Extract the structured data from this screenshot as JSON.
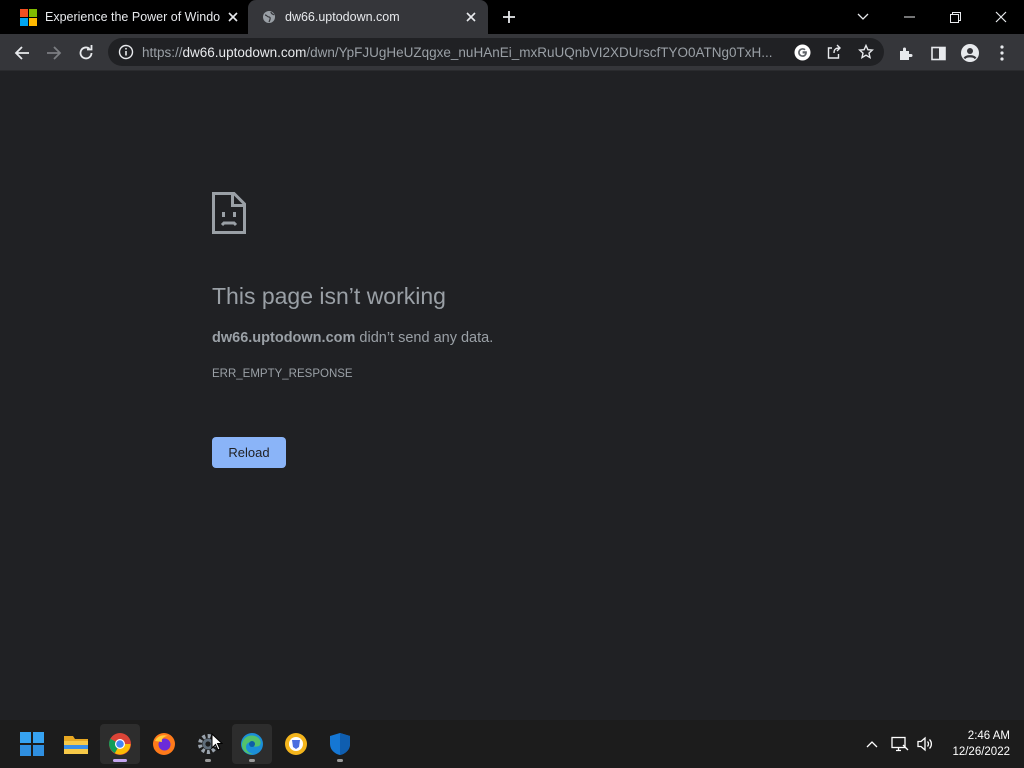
{
  "tabs": [
    {
      "title": "Experience the Power of Windows",
      "favicon": "microsoft-logo",
      "active": false
    },
    {
      "title": "dw66.uptodown.com",
      "favicon": "globe-icon",
      "active": true
    }
  ],
  "url": {
    "scheme": "https://",
    "host": "dw66.uptodown.com",
    "path": "/dwn/YpFJUgHeUZqgxe_nuHAnEi_mxRuUQnbVI2XDUrscfTYO0ATNg0TxH..."
  },
  "error": {
    "title": "This page isn’t working",
    "host": "dw66.uptodown.com",
    "message": "didn’t send any data.",
    "code": "ERR_EMPTY_RESPONSE",
    "reload_label": "Reload"
  },
  "taskbar": {
    "apps": [
      "start-icon",
      "file-explorer-icon",
      "chrome-icon",
      "firefox-icon",
      "settings-icon",
      "edge-icon",
      "brave-icon",
      "defender-icon"
    ],
    "time": "2:46 AM",
    "date": "12/26/2022"
  },
  "colors": {
    "page_bg": "#202124",
    "toolbar_bg": "#35363a",
    "accent": "#8ab4f8",
    "text_muted": "#9aa0a6"
  }
}
